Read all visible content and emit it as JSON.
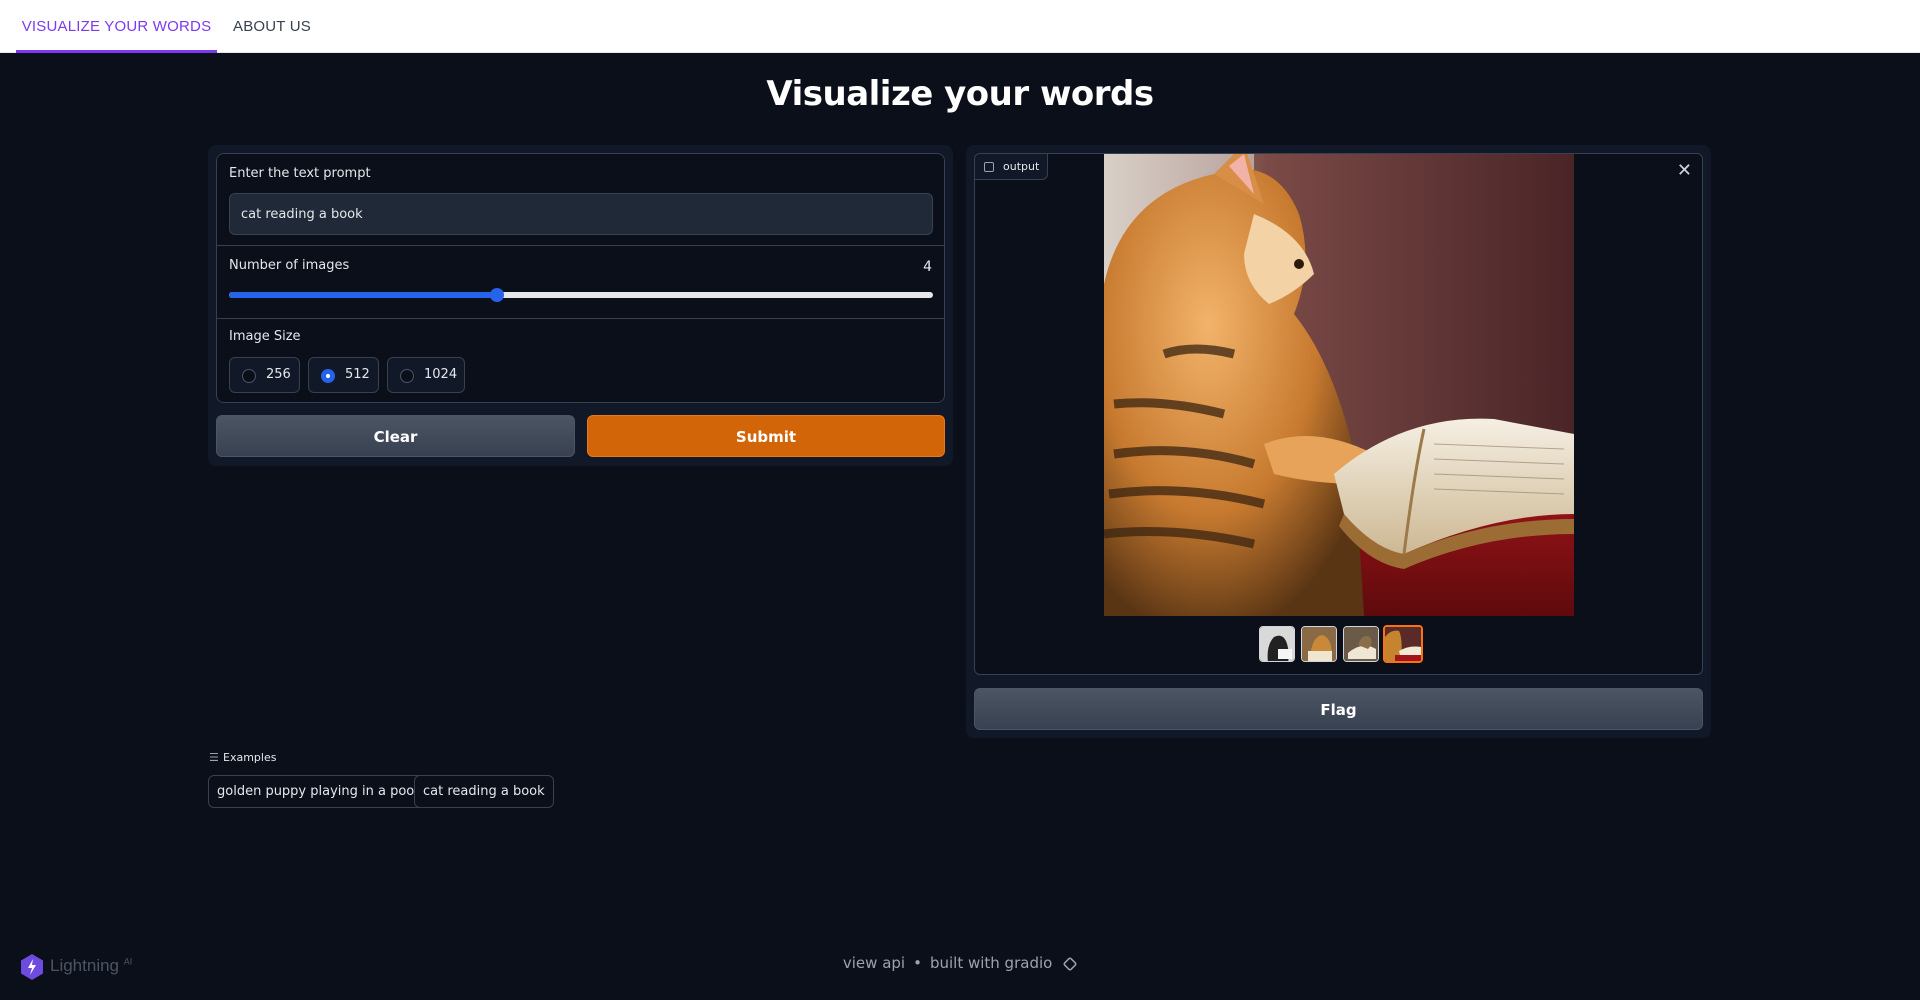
{
  "nav": {
    "tabs": [
      {
        "label": "VISUALIZE YOUR WORDS",
        "active": true
      },
      {
        "label": "ABOUT US",
        "active": false
      }
    ]
  },
  "page": {
    "title": "Visualize your words"
  },
  "form": {
    "prompt": {
      "label": "Enter the text prompt",
      "value": "cat reading a book"
    },
    "num_images": {
      "label": "Number of images",
      "value": "4",
      "slider_fraction": 0.38
    },
    "image_size": {
      "label": "Image Size",
      "options": [
        "256",
        "512",
        "1024"
      ],
      "selected": "512"
    },
    "clear_label": "Clear",
    "submit_label": "Submit"
  },
  "output": {
    "label": "output",
    "thumbnail_count": 4,
    "selected_thumbnail": 4,
    "flag_label": "Flag"
  },
  "examples": {
    "header": "Examples",
    "items": [
      "golden puppy playing in a pool",
      "cat reading a book"
    ]
  },
  "footer": {
    "view_api": "view api",
    "separator": "•",
    "built_with": "built with gradio",
    "logo_text": "Lightning",
    "logo_sup": "AI"
  },
  "colors": {
    "accent": "#7c3aed",
    "submit": "#d26508",
    "slider": "#2563eb",
    "background": "#0b0f19"
  }
}
